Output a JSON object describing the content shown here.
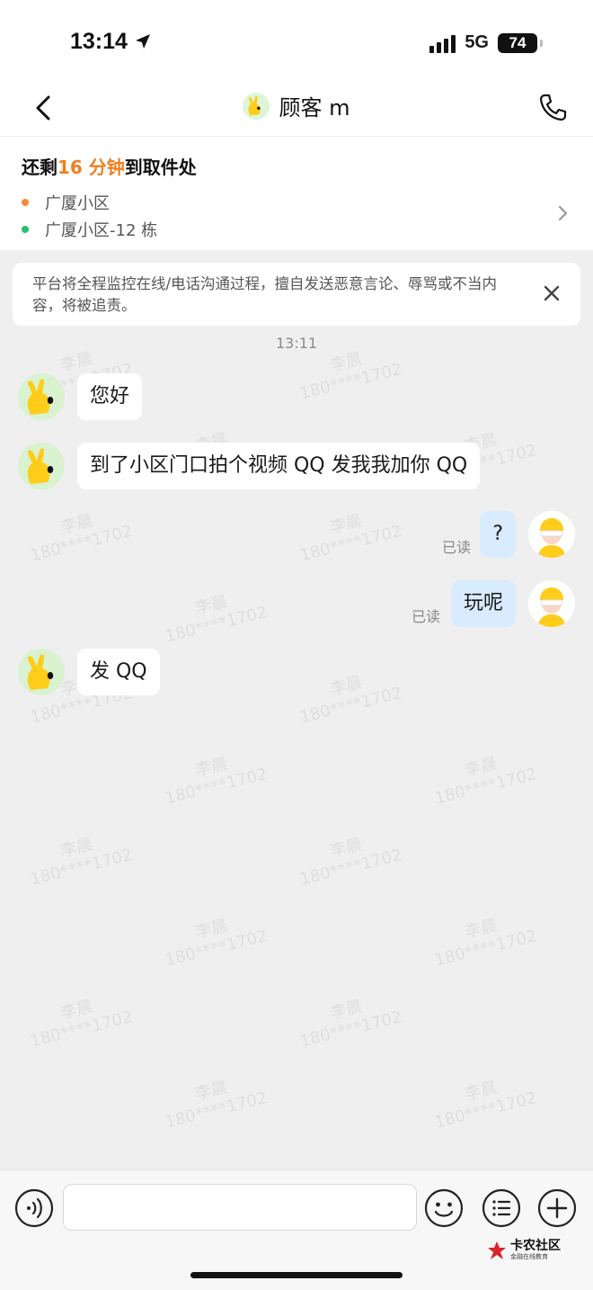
{
  "status": {
    "time": "13:14",
    "network": "5G",
    "battery": "74"
  },
  "nav": {
    "title": "顾客 m"
  },
  "order": {
    "prefix": "还剩",
    "minutes": "16 分钟",
    "suffix": "到取件处",
    "pickup_address": "广厦小区",
    "delivery_address": "广厦小区-12 栋",
    "pickup_dot_color": "#f28a3a",
    "delivery_dot_color": "#22c36a"
  },
  "notice": {
    "text": "平台将全程监控在线/电话沟通过程，擅自发送恶意言论、辱骂或不当内容，将被追责。"
  },
  "chat": {
    "time_separator": "13:11",
    "messages": [
      {
        "side": "left",
        "text": "您好"
      },
      {
        "side": "left",
        "text": "到了小区门口拍个视频 QQ 发我我加你 QQ"
      },
      {
        "side": "right",
        "text": "?",
        "status": "已读"
      },
      {
        "side": "right",
        "text": "玩呢",
        "status": "已读"
      },
      {
        "side": "left",
        "text": "发 QQ"
      }
    ]
  },
  "watermark": {
    "name": "李晨",
    "phone": "180****1702"
  },
  "input_bar": {
    "placeholder": "",
    "voice_icon": "voice-icon",
    "emoji_icon": "emoji-icon",
    "menu_icon": "list-icon",
    "plus_icon": "plus-icon"
  },
  "brand": {
    "name": "卡农社区",
    "tagline": "金融在线教育"
  },
  "colors": {
    "accent": "#f07f1e",
    "bubble_self": "#d8ebff",
    "background": "#efefef"
  }
}
